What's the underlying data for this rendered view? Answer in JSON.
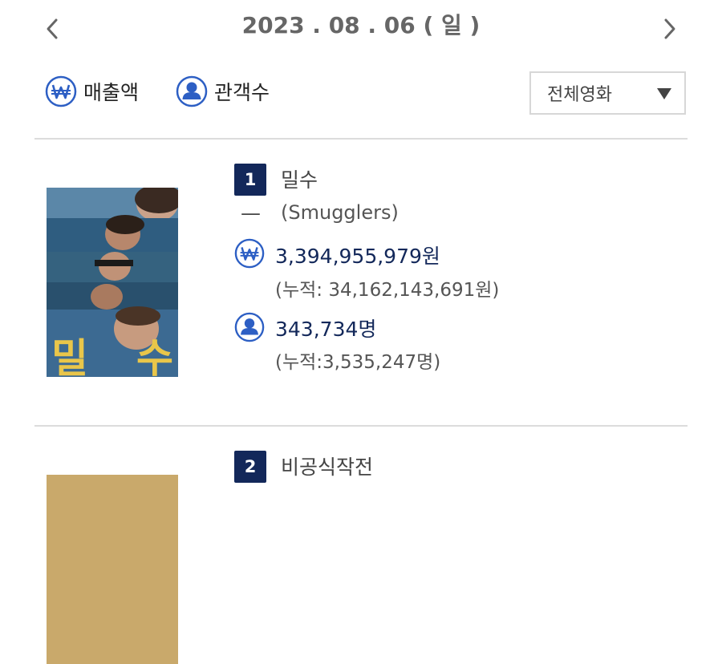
{
  "date_nav": {
    "date": "2023 . 08 . 06 ( 일 )",
    "prev_icon": "chevron-left-icon",
    "next_icon": "chevron-right-icon"
  },
  "filters": {
    "revenue_label": "매출액",
    "revenue_icon": "won-icon",
    "audience_label": "관객수",
    "audience_icon": "person-icon",
    "movie_select_value": "전체영화"
  },
  "colors": {
    "accent": "#13285a",
    "icon_blue": "#2d5fc4"
  },
  "movies": [
    {
      "rank": "1",
      "title": "밀수",
      "change": "—",
      "title_en": "(Smugglers)",
      "revenue": "3,394,955,979원",
      "revenue_total": "(누적: 34,162,143,691원)",
      "audience": "343,734명",
      "audience_total": "(누적:3,535,247명)",
      "poster_text_left": "밀",
      "poster_text_right": "수"
    },
    {
      "rank": "2",
      "title": "비공식작전"
    }
  ]
}
